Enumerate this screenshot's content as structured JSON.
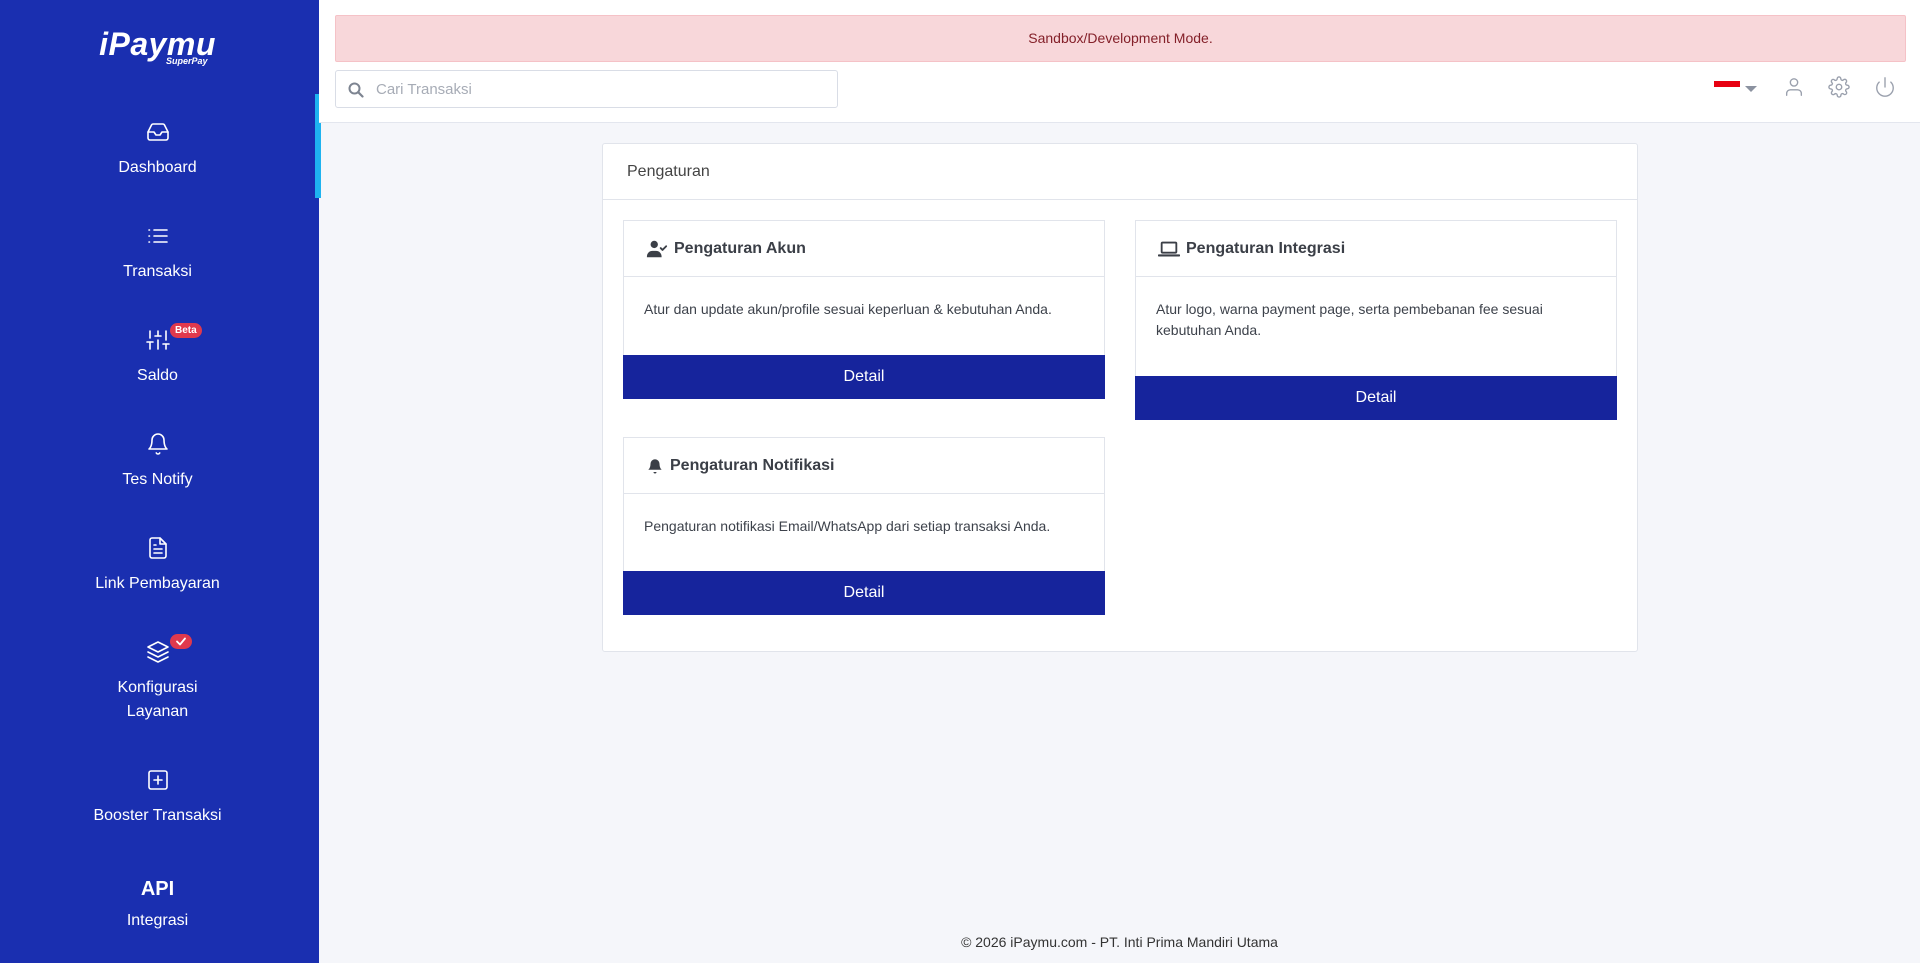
{
  "brand": {
    "name": "iPaymu",
    "sub": "SuperPay"
  },
  "sidebar": {
    "items": [
      {
        "label": "Dashboard",
        "icon": "inbox-icon"
      },
      {
        "label": "Transaksi",
        "icon": "list-icon"
      },
      {
        "label": "Saldo",
        "icon": "sliders-icon",
        "badge": "Beta"
      },
      {
        "label": "Tes Notify",
        "icon": "bell-icon"
      },
      {
        "label": "Link Pembayaran",
        "icon": "document-icon"
      },
      {
        "label": "Konfigurasi Layanan",
        "icon": "layers-icon",
        "badge_icon": "check-icon"
      },
      {
        "label": "Booster Transaksi",
        "icon": "plus-square-icon"
      },
      {
        "label": "Integrasi",
        "icon_text": "API"
      }
    ],
    "active_index": 0
  },
  "topbar": {
    "alert": "Sandbox/Development Mode.",
    "search_placeholder": "Cari Transaksi",
    "language_flag": "indonesia-flag-icon",
    "icons": [
      "user-icon",
      "gear-icon",
      "power-icon"
    ]
  },
  "settings": {
    "title": "Pengaturan",
    "cards": [
      {
        "title": "Pengaturan Akun",
        "icon": "user-check-icon",
        "description": "Atur dan update akun/profile sesuai keperluan & kebutuhan Anda.",
        "button": "Detail"
      },
      {
        "title": "Pengaturan Integrasi",
        "icon": "laptop-icon",
        "description": "Atur logo, warna payment page, serta pembebanan fee sesuai kebutuhan Anda.",
        "button": "Detail"
      },
      {
        "title": "Pengaturan Notifikasi",
        "icon": "bell-icon",
        "description": "Pengaturan notifikasi Email/WhatsApp dari setiap transaksi Anda.",
        "button": "Detail"
      }
    ]
  },
  "footer": "© 2026 iPaymu.com - PT. Inti Prima Mandiri Utama",
  "colors": {
    "sidebar": "#1a2fb0",
    "button": "#16249c",
    "active_indicator": "#1eb3f0",
    "alert_bg": "#f8d7da",
    "alert_text": "#842029",
    "badge": "#e0394d"
  }
}
